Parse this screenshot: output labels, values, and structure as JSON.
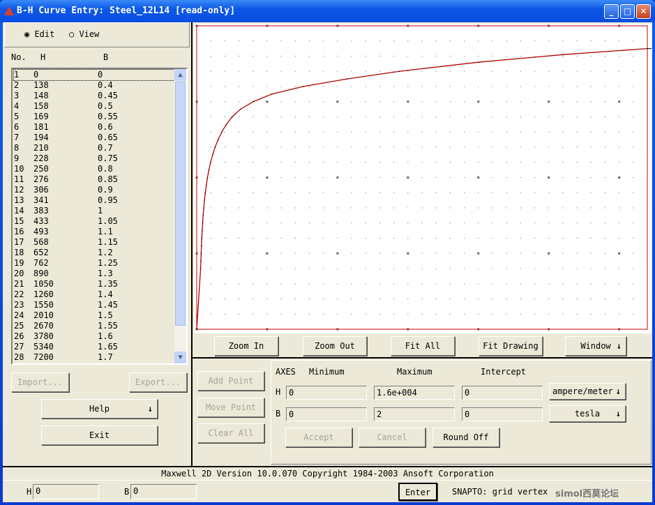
{
  "window": {
    "title": "B-H Curve Entry: Steel_12L14 [read-only]",
    "controls": [
      "_",
      "□",
      "✕"
    ]
  },
  "mode": {
    "options": [
      "Edit",
      "View"
    ],
    "selected": "Edit"
  },
  "table": {
    "headers": [
      "No.",
      "H",
      "B"
    ],
    "rows": [
      [
        "1",
        "0",
        "0"
      ],
      [
        "2",
        "138",
        "0.4"
      ],
      [
        "3",
        "148",
        "0.45"
      ],
      [
        "4",
        "158",
        "0.5"
      ],
      [
        "5",
        "169",
        "0.55"
      ],
      [
        "6",
        "181",
        "0.6"
      ],
      [
        "7",
        "194",
        "0.65"
      ],
      [
        "8",
        "210",
        "0.7"
      ],
      [
        "9",
        "228",
        "0.75"
      ],
      [
        "10",
        "250",
        "0.8"
      ],
      [
        "11",
        "276",
        "0.85"
      ],
      [
        "12",
        "306",
        "0.9"
      ],
      [
        "13",
        "341",
        "0.95"
      ],
      [
        "14",
        "383",
        "1"
      ],
      [
        "15",
        "433",
        "1.05"
      ],
      [
        "16",
        "493",
        "1.1"
      ],
      [
        "17",
        "568",
        "1.15"
      ],
      [
        "18",
        "652",
        "1.2"
      ],
      [
        "19",
        "762",
        "1.25"
      ],
      [
        "20",
        "890",
        "1.3"
      ],
      [
        "21",
        "1050",
        "1.35"
      ],
      [
        "22",
        "1260",
        "1.4"
      ],
      [
        "23",
        "1550",
        "1.45"
      ],
      [
        "24",
        "2010",
        "1.5"
      ],
      [
        "25",
        "2670",
        "1.55"
      ],
      [
        "26",
        "3780",
        "1.6"
      ],
      [
        "27",
        "5340",
        "1.65"
      ],
      [
        "28",
        "7200",
        "1.7"
      ]
    ]
  },
  "left_buttons": {
    "import": "Import...",
    "export": "Export...",
    "help": "Help",
    "exit": "Exit"
  },
  "plot_buttons": {
    "zoom_in": "Zoom In",
    "zoom_out": "Zoom Out",
    "fit_all": "Fit All",
    "fit_drawing": "Fit Drawing",
    "window": "Window"
  },
  "point_buttons": {
    "add": "Add Point",
    "move": "Move Point",
    "clear": "Clear All"
  },
  "axes": {
    "header": "AXES",
    "col_min": "Minimum",
    "col_max": "Maximum",
    "col_int": "Intercept",
    "h": {
      "label": "H",
      "min": "0",
      "max": "1.6e+004",
      "intercept": "0",
      "unit": "ampere/meter"
    },
    "b": {
      "label": "B",
      "min": "0",
      "max": "2",
      "intercept": "0",
      "unit": "tesla"
    },
    "accept": "Accept",
    "cancel": "Cancel",
    "round_off": "Round Off"
  },
  "status": {
    "text": "Maxwell 2D   Version 10.0.070   Copyright 1984-2003 Ansoft Corporation"
  },
  "bottom": {
    "h_label": "H",
    "h_value": "0",
    "b_label": "B",
    "b_value": "0",
    "enter": "Enter",
    "snap": "SNAPTO: grid vertex",
    "watermark": "simol西莫论坛"
  },
  "chart_data": {
    "type": "line",
    "xlim": [
      0,
      16000
    ],
    "ylim": [
      0,
      2
    ],
    "x_grid_major": 2500,
    "y_grid_major": 0.5,
    "grid": true,
    "line_color": "#b00000",
    "frame_color": "#c00000",
    "x": [
      0,
      138,
      148,
      158,
      169,
      181,
      194,
      210,
      228,
      250,
      276,
      306,
      341,
      383,
      433,
      493,
      568,
      652,
      762,
      890,
      1050,
      1260,
      1550,
      2010,
      2670,
      3780,
      5340,
      7200,
      10000,
      13000,
      16000
    ],
    "y": [
      0,
      0.4,
      0.45,
      0.5,
      0.55,
      0.6,
      0.65,
      0.7,
      0.75,
      0.8,
      0.85,
      0.9,
      0.95,
      1,
      1.05,
      1.1,
      1.15,
      1.2,
      1.25,
      1.3,
      1.35,
      1.4,
      1.45,
      1.5,
      1.55,
      1.6,
      1.65,
      1.7,
      1.76,
      1.81,
      1.85
    ]
  }
}
